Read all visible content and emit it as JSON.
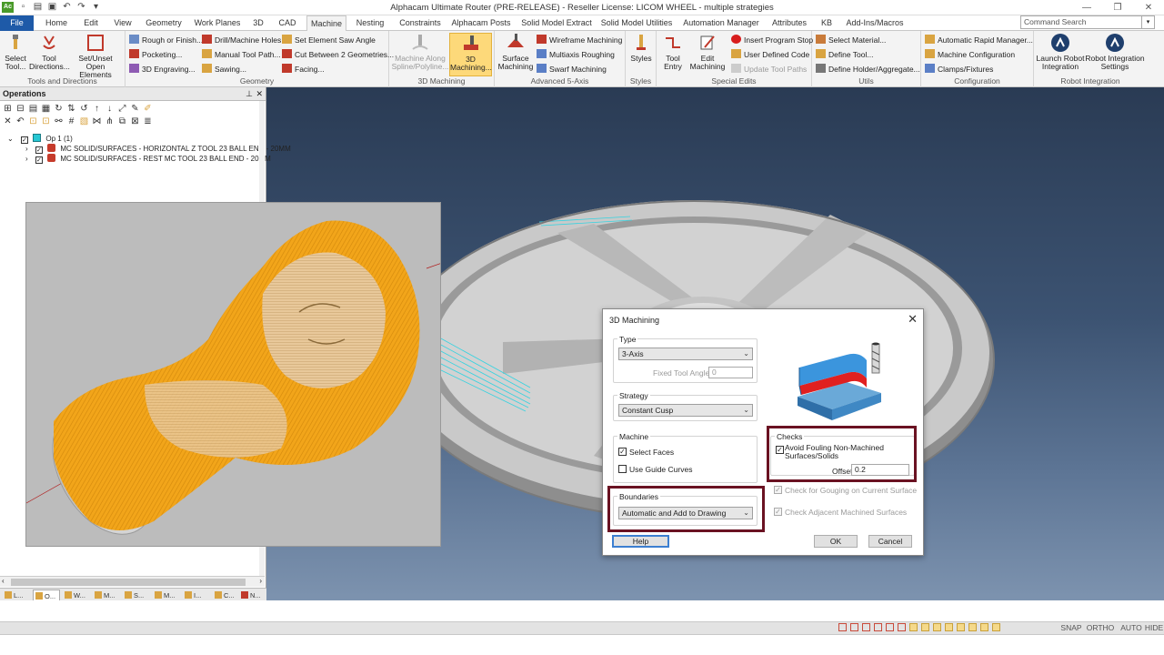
{
  "window": {
    "title": "Alphacam Ultimate Router (PRE-RELEASE) - Reseller License: LICOM WHEEL - multiple strategies",
    "app_icon": "Ac"
  },
  "menu": {
    "tabs": [
      "File",
      "Home",
      "Edit",
      "View",
      "Geometry",
      "Work Planes",
      "3D",
      "CAD",
      "Machine",
      "Nesting",
      "Constraints",
      "Alphacam Posts",
      "Solid Model Extract",
      "Solid Model Utilities",
      "Automation Manager",
      "Attributes",
      "KB",
      "Add-Ins/Macros"
    ],
    "active": "Machine",
    "command_search_placeholder": "Command Search"
  },
  "ribbon": {
    "groups": {
      "tools_directions": "Tools and Directions",
      "geometry": "Geometry",
      "machining_3d": "3D Machining",
      "advanced_5axis": "Advanced 5-Axis",
      "styles": "Styles",
      "special_edits": "Special Edits",
      "utils": "Utils",
      "configuration": "Configuration",
      "robot_integration": "Robot Integration"
    },
    "buttons": {
      "select_tool": "Select Tool...",
      "tool_directions": "Tool Directions...",
      "set_unset_open": "Set/Unset Open Elements",
      "rough_or_finish": "Rough or Finish...",
      "pocketing": "Pocketing...",
      "engraving_3d": "3D Engraving...",
      "drill_holes": "Drill/Machine Holes",
      "manual_toolpath": "Manual Tool Path...",
      "sawing": "Sawing...",
      "set_saw_angle": "Set Element Saw Angle",
      "cut_between": "Cut Between 2 Geometries...",
      "facing": "Facing...",
      "machine_along": "Machine Along Spline/Polyline...",
      "machining_3d": "3D Machining...",
      "surface_machining": "Surface Machining",
      "wireframe": "Wireframe Machining",
      "multiaxis": "Multiaxis Roughing",
      "swarf": "Swarf Machining",
      "styles": "Styles",
      "tool_entry": "Tool Entry",
      "edit_machining": "Edit Machining",
      "insert_stop": "Insert Program Stop",
      "user_code": "User Defined Code",
      "update_toolpaths": "Update Tool Paths",
      "select_material": "Select Material...",
      "define_tool": "Define Tool...",
      "define_holder": "Define Holder/Aggregate...",
      "auto_rapid": "Automatic Rapid Manager...",
      "machine_config": "Machine Configuration",
      "clamps": "Clamps/Fixtures",
      "launch_robot": "Launch Robot Integration",
      "robot_settings": "Robot Integration Settings"
    }
  },
  "operations": {
    "title": "Operations",
    "op_label": "Op 1  (1)",
    "items": [
      "MC SOLID/SURFACES - HORIZONTAL Z   TOOL 23   BALL END - 20MM",
      "MC SOLID/SURFACES - REST MC   TOOL 23   BALL END - 20MM"
    ],
    "bottom_tabs": [
      "L...",
      "O...",
      "W...",
      "M...",
      "S...",
      "M...",
      "I...",
      "C...",
      "N..."
    ]
  },
  "dialog": {
    "title": "3D Machining",
    "type_group": "Type",
    "type_value": "3-Axis",
    "fixed_angle_label": "Fixed Tool Angle",
    "fixed_angle_value": "0",
    "strategy_group": "Strategy",
    "strategy_value": "Constant Cusp",
    "machine_group": "Machine",
    "select_faces": "Select Faces",
    "use_guide": "Use Guide Curves",
    "boundaries_group": "Boundaries",
    "boundaries_value": "Automatic and Add to Drawing",
    "checks_group": "Checks",
    "avoid_fouling": "Avoid Fouling Non-Machined Surfaces/Solids",
    "offset_label": "Offset",
    "offset_value": "0.2",
    "check_gouging": "Check for Gouging on Current Surface",
    "check_adjacent": "Check Adjacent Machined Surfaces",
    "help": "Help",
    "ok": "OK",
    "cancel": "Cancel"
  },
  "status": {
    "snap": "SNAP",
    "ortho": "ORTHO",
    "auto": "AUTO",
    "hide": "HIDE"
  },
  "colors": {
    "file_tab": "#1e5aa8",
    "toolpath_orange": "#f2a51a",
    "highlight_box": "#6a1222",
    "viewport_top": "#2a3b54"
  }
}
